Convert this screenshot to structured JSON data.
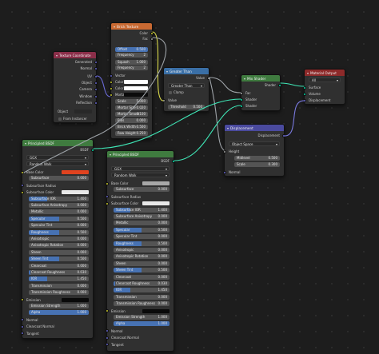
{
  "colors": {
    "texture_header": "#c86932",
    "converter_header": "#3a6fa6",
    "shader_header": "#3f7b3f",
    "output_header": "#8e2a2a",
    "vector_header": "#4a4a9e",
    "input_header": "#8b2e49",
    "socket_color": "#c7c729",
    "socket_float": "#a1a1a1",
    "socket_vector": "#6363c7",
    "socket_shader": "#00d6a3",
    "selected": "#4772b3"
  },
  "texcoord": {
    "title": "Texture Coordinate",
    "outputs": [
      "Generated",
      "Normal",
      "UV",
      "Object",
      "Camera",
      "Window",
      "Reflection"
    ],
    "object_label": "Object",
    "from_instancer": "From Instancer"
  },
  "brick": {
    "title": "Brick Texture",
    "outputs": [
      "Color",
      "Fac"
    ],
    "offset_label": "Offset",
    "offset_val": "0.500",
    "freq1_label": "Frequency",
    "freq1_val": "2",
    "squash_label": "Squash",
    "squash_val": "1.000",
    "freq2_label": "Frequency",
    "freq2_val": "2",
    "inputs": [
      "Vector",
      "Color1",
      "Color2",
      "Mortar"
    ],
    "scale_label": "Scale",
    "scale_val": "5.000",
    "mortar_size_label": "Mortar Size",
    "mortar_size_val": "0.020",
    "mortar_smooth_label": "Mortar Smoot",
    "mortar_smooth_val": "0.100",
    "bias_label": "Bias",
    "bias_val": "0.000",
    "brick_width_label": "Brick Width",
    "brick_width_val": "0.500",
    "row_height_label": "Row Height",
    "row_height_val": "0.250"
  },
  "greater": {
    "title": "Greater Than",
    "output": "Value",
    "op": "Greater Than",
    "clamp": "Clamp",
    "input": "Value",
    "threshold_label": "Threshold",
    "threshold_val": "0.500"
  },
  "mix": {
    "title": "Mix Shader",
    "output": "Shader",
    "inputs": [
      "Fac",
      "Shader",
      "Shader"
    ]
  },
  "matout": {
    "title": "Material Output",
    "target": "All",
    "inputs": [
      "Surface",
      "Volume",
      "Displacement"
    ]
  },
  "disp": {
    "title": "Displacement",
    "output": "Displacement",
    "space": "Object Space",
    "height": "Height",
    "midlevel_label": "Midlevel",
    "midlevel_val": "0.500",
    "scale_label": "Scale",
    "scale_val": "0.300",
    "normal": "Normal"
  },
  "bsdf1": {
    "title": "Principled BSDF",
    "output": "BSDF",
    "distribution": "GGX",
    "subsurface_method": "Random Walk",
    "rows": [
      {
        "k": "socket",
        "label": "Base Color",
        "swatch": "#e0431f"
      },
      {
        "k": "field",
        "label": "Subsurface",
        "val": "0.000",
        "fill": 0
      },
      {
        "k": "vec",
        "label": "Subsurface Radius"
      },
      {
        "k": "socket",
        "label": "Subsurface Color",
        "swatch": "#e8e8e8"
      },
      {
        "k": "field",
        "label": "Subsurface IOR",
        "val": "1.400",
        "fill": 0.3
      },
      {
        "k": "field",
        "label": "Subsurface Anisotropy",
        "val": "0.000",
        "fill": 0
      },
      {
        "k": "field",
        "label": "Metallic",
        "val": "0.000",
        "fill": 0
      },
      {
        "k": "field",
        "label": "Specular",
        "val": "0.500",
        "fill": 0.5
      },
      {
        "k": "field",
        "label": "Specular Tint",
        "val": "0.000",
        "fill": 0
      },
      {
        "k": "field",
        "label": "Roughness",
        "val": "0.500",
        "fill": 0.5
      },
      {
        "k": "field",
        "label": "Anisotropic",
        "val": "0.000",
        "fill": 0
      },
      {
        "k": "field",
        "label": "Anisotropic Rotation",
        "val": "0.000",
        "fill": 0
      },
      {
        "k": "field",
        "label": "Sheen",
        "val": "0.000",
        "fill": 0
      },
      {
        "k": "field",
        "label": "Sheen Tint",
        "val": "0.500",
        "fill": 0.5
      },
      {
        "k": "field",
        "label": "Clearcoat",
        "val": "0.000",
        "fill": 0
      },
      {
        "k": "field",
        "label": "Clearcoat Roughness",
        "val": "0.030",
        "fill": 0.03
      },
      {
        "k": "field",
        "label": "IOR",
        "val": "1.450",
        "fill": 0.3
      },
      {
        "k": "field",
        "label": "Transmission",
        "val": "0.000",
        "fill": 0
      },
      {
        "k": "field",
        "label": "Transmission Roughness",
        "val": "0.000",
        "fill": 0
      },
      {
        "k": "socket",
        "label": "Emission",
        "swatch": "#0a0a0a"
      },
      {
        "k": "field",
        "label": "Emission Strength",
        "val": "1.000",
        "fill": 0
      },
      {
        "k": "field",
        "label": "Alpha",
        "val": "1.000",
        "fill": 1
      },
      {
        "k": "vec",
        "label": "Normal"
      },
      {
        "k": "vec",
        "label": "Clearcoat Normal"
      },
      {
        "k": "vec",
        "label": "Tangent"
      }
    ]
  },
  "bsdf2": {
    "title": "Principled BSDF",
    "output": "BSDF",
    "distribution": "GGX",
    "subsurface_method": "Random Walk",
    "rows": [
      {
        "k": "socket",
        "label": "Base Color",
        "swatch": "#a8a8a8"
      },
      {
        "k": "field",
        "label": "Subsurface",
        "val": "0.000",
        "fill": 0
      },
      {
        "k": "vec",
        "label": "Subsurface Radius"
      },
      {
        "k": "socket",
        "label": "Subsurface Color",
        "swatch": "#e8e8e8"
      },
      {
        "k": "field",
        "label": "Subsurface IOR",
        "val": "1.400",
        "fill": 0.3
      },
      {
        "k": "field",
        "label": "Subsurface Anisotropy",
        "val": "0.000",
        "fill": 0
      },
      {
        "k": "field",
        "label": "Metallic",
        "val": "0.000",
        "fill": 0
      },
      {
        "k": "field",
        "label": "Specular",
        "val": "0.500",
        "fill": 0.5
      },
      {
        "k": "field",
        "label": "Specular Tint",
        "val": "0.000",
        "fill": 0
      },
      {
        "k": "field",
        "label": "Roughness",
        "val": "0.500",
        "fill": 0.5
      },
      {
        "k": "field",
        "label": "Anisotropic",
        "val": "0.000",
        "fill": 0
      },
      {
        "k": "field",
        "label": "Anisotropic Rotation",
        "val": "0.000",
        "fill": 0
      },
      {
        "k": "field",
        "label": "Sheen",
        "val": "0.000",
        "fill": 0
      },
      {
        "k": "field",
        "label": "Sheen Tint",
        "val": "0.500",
        "fill": 0.5
      },
      {
        "k": "field",
        "label": "Clearcoat",
        "val": "0.000",
        "fill": 0
      },
      {
        "k": "field",
        "label": "Clearcoat Roughness",
        "val": "0.030",
        "fill": 0.03
      },
      {
        "k": "field",
        "label": "IOR",
        "val": "1.450",
        "fill": 0.3
      },
      {
        "k": "field",
        "label": "Transmission",
        "val": "0.000",
        "fill": 0
      },
      {
        "k": "field",
        "label": "Transmission Roughness",
        "val": "0.000",
        "fill": 0
      },
      {
        "k": "socket",
        "label": "Emission",
        "swatch": "#0a0a0a"
      },
      {
        "k": "field",
        "label": "Emission Strength",
        "val": "1.000",
        "fill": 0
      },
      {
        "k": "field",
        "label": "Alpha",
        "val": "1.000",
        "fill": 1
      },
      {
        "k": "vec",
        "label": "Normal"
      },
      {
        "k": "vec",
        "label": "Clearcoat Normal"
      },
      {
        "k": "vec",
        "label": "Tangent"
      }
    ]
  }
}
